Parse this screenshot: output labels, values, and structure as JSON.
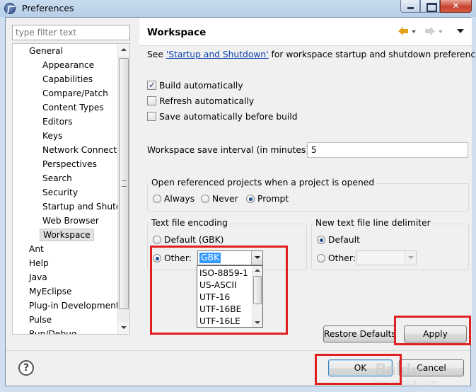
{
  "window": {
    "title": "Preferences"
  },
  "sidebar": {
    "filter_placeholder": "type filter text",
    "items": [
      {
        "label": "General",
        "level": 1
      },
      {
        "label": "Appearance",
        "level": 2
      },
      {
        "label": "Capabilities",
        "level": 2
      },
      {
        "label": "Compare/Patch",
        "level": 2
      },
      {
        "label": "Content Types",
        "level": 2
      },
      {
        "label": "Editors",
        "level": 2
      },
      {
        "label": "Keys",
        "level": 2
      },
      {
        "label": "Network Connecti",
        "level": 2
      },
      {
        "label": "Perspectives",
        "level": 2
      },
      {
        "label": "Search",
        "level": 2
      },
      {
        "label": "Security",
        "level": 2
      },
      {
        "label": "Startup and Shutd",
        "level": 2
      },
      {
        "label": "Web Browser",
        "level": 2
      },
      {
        "label": "Workspace",
        "level": 2,
        "selected": true
      },
      {
        "label": "Ant",
        "level": 1
      },
      {
        "label": "Help",
        "level": 1
      },
      {
        "label": "Java",
        "level": 1
      },
      {
        "label": "MyEclipse",
        "level": 1
      },
      {
        "label": "Plug-in Development",
        "level": 1
      },
      {
        "label": "Pulse",
        "level": 1
      },
      {
        "label": "Run/Debug",
        "level": 1
      }
    ]
  },
  "page": {
    "title": "Workspace",
    "desc_prefix": "See ",
    "desc_link": "'Startup and Shutdown'",
    "desc_suffix": " for workspace startup and shutdown preferences.",
    "build_auto_label": "Build automatically",
    "build_auto_checked": true,
    "refresh_auto_label": "Refresh automatically",
    "refresh_auto_checked": false,
    "save_before_build_label": "Save automatically before build",
    "save_before_build_checked": false,
    "interval_label": "Workspace save interval (in minutes):",
    "interval_value": "5",
    "open_projects": {
      "title": "Open referenced projects when a project is opened",
      "options": [
        "Always",
        "Never",
        "Prompt"
      ],
      "selected": "Prompt"
    },
    "encoding": {
      "title": "Text file encoding",
      "default_label": "Default (GBK)",
      "other_label": "Other:",
      "selected": "Other:",
      "other_value": "GBK",
      "dropdown_options": [
        "ISO-8859-1",
        "US-ASCII",
        "UTF-16",
        "UTF-16BE",
        "UTF-16LE"
      ]
    },
    "line_delimiter": {
      "title": "New text file line delimiter",
      "default_label": "Default",
      "other_label": "Other:",
      "selected": "Default",
      "other_value": ""
    },
    "restore_defaults_label": "Restore Defaults",
    "apply_label": "Apply"
  },
  "footer": {
    "help_glyph": "?",
    "ok_label": "OK",
    "cancel_label": "Cancel"
  },
  "annotations": {
    "highlight_color": "#e02020"
  },
  "watermark": {
    "text": "Baidu",
    "sub": "jingyan.baidu.com"
  }
}
